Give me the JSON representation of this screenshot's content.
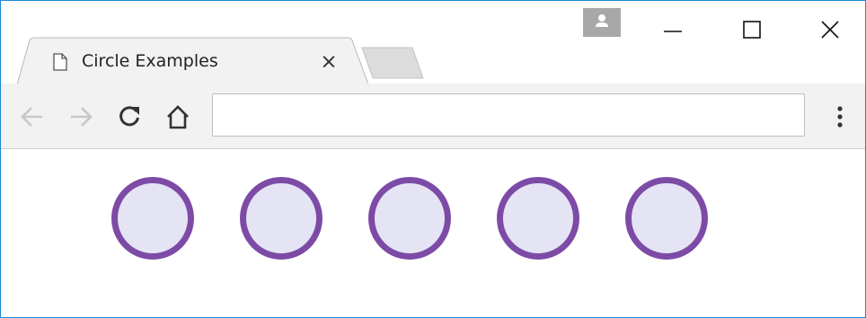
{
  "tab": {
    "title": "Circle Examples",
    "close_label": "×",
    "page_icon": "page-icon"
  },
  "toolbar": {
    "back_icon": "arrow-left-icon",
    "forward_icon": "arrow-right-icon",
    "reload_icon": "reload-icon",
    "home_icon": "home-icon",
    "menu_icon": "kebab-menu-icon"
  },
  "address_bar": {
    "value": "",
    "placeholder": ""
  },
  "window_controls": {
    "profile_icon": "profile-icon",
    "minimize_icon": "minimize-icon",
    "maximize_icon": "maximize-icon",
    "close_icon": "close-icon"
  },
  "content": {
    "circles": [
      {
        "fill": "#e5e4f5",
        "stroke": "#7d4ba6"
      },
      {
        "fill": "#e5e4f5",
        "stroke": "#7d4ba6"
      },
      {
        "fill": "#e5e4f5",
        "stroke": "#7d4ba6"
      },
      {
        "fill": "#e5e4f5",
        "stroke": "#7d4ba6"
      },
      {
        "fill": "#e5e4f5",
        "stroke": "#7d4ba6"
      }
    ]
  },
  "colors": {
    "window_border": "#1c8ad6",
    "toolbar_bg": "#f2f2f2",
    "circle_fill": "#e5e4f5",
    "circle_stroke": "#7d4ba6"
  }
}
